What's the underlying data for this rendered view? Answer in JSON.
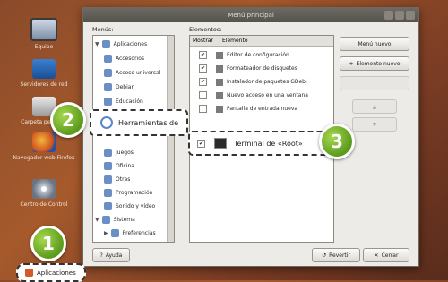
{
  "desktop": {
    "icons": [
      {
        "label": "Equipo",
        "icon": "computer-icon"
      },
      {
        "label": "Servidores de red",
        "icon": "network-icon"
      },
      {
        "label": "Carpeta personal",
        "icon": "home-folder-icon"
      },
      {
        "label": "Navegador web Firefox",
        "icon": "firefox-icon"
      },
      {
        "label": "Centro de Control",
        "icon": "control-center-icon"
      }
    ]
  },
  "window": {
    "title": "Menú principal",
    "menus_label": "Menús:",
    "elements_label": "Elementos:",
    "menus": [
      {
        "label": "Aplicaciones",
        "level": 0,
        "expanded": true
      },
      {
        "label": "Accesorios",
        "level": 1
      },
      {
        "label": "Acceso universal",
        "level": 1
      },
      {
        "label": "Debian",
        "level": 1
      },
      {
        "label": "Educación",
        "level": 1
      },
      {
        "label": "Herramientas de",
        "level": 1
      },
      {
        "label": "Juegos",
        "level": 1
      },
      {
        "label": "Oficina",
        "level": 1
      },
      {
        "label": "Otras",
        "level": 1
      },
      {
        "label": "Programación",
        "level": 1
      },
      {
        "label": "Sonido y vídeo",
        "level": 1
      },
      {
        "label": "Sistema",
        "level": 0,
        "expanded": true
      },
      {
        "label": "Preferencias",
        "level": 1
      }
    ],
    "elements_header": {
      "show": "Mostrar",
      "element": "Elemento"
    },
    "elements": [
      {
        "label": "Editor de configuración",
        "checked": true
      },
      {
        "label": "Formateador de disquetes",
        "checked": true
      },
      {
        "label": "Instalador de paquetes GDebi",
        "checked": true
      },
      {
        "label": "Nuevo acceso en una ventana",
        "checked": false
      },
      {
        "label": "Pantalla de entrada nueva",
        "checked": false
      },
      {
        "label": "Terminal de «Root»",
        "checked": true
      }
    ],
    "buttons": {
      "new_menu": "Menú nuevo",
      "new_element": "Elemento nuevo",
      "help": "Ayuda",
      "revert": "Revertir",
      "close": "Cerrar"
    }
  },
  "callouts": {
    "step1": "1",
    "step2": "2",
    "step3": "3",
    "applications_menu": "Aplicaciones",
    "highlight_menu": "Herramientas de",
    "highlight_element": "Terminal de «Root»"
  }
}
